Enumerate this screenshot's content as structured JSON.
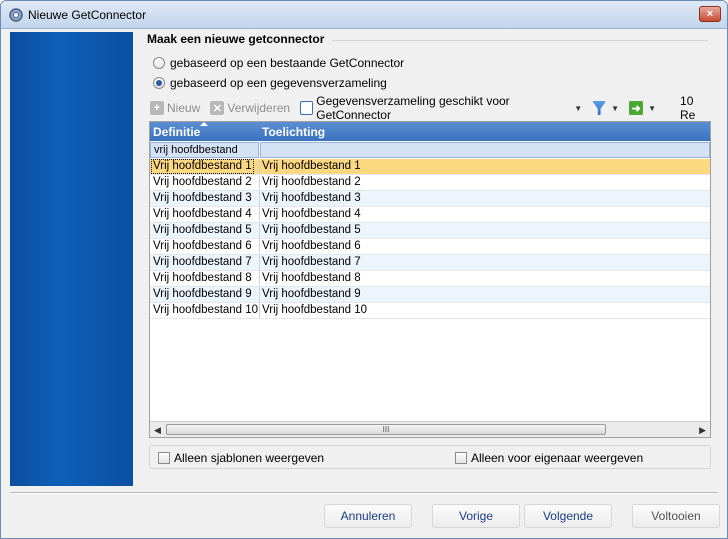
{
  "window": {
    "title": "Nieuwe GetConnector",
    "close_label": "×"
  },
  "section": {
    "title": "Maak een nieuwe getconnector"
  },
  "options": [
    {
      "label": "gebaseerd op een bestaande GetConnector",
      "selected": false
    },
    {
      "label": "gebaseerd op een gegevensverzameling",
      "selected": true
    }
  ],
  "toolbar": {
    "new_label": "Nieuw",
    "delete_label": "Verwijderen",
    "dataset_label": "Gegevensverzameling geschikt voor GetConnector",
    "record_count": "10 Re"
  },
  "grid": {
    "columns": [
      "Definitie",
      "Toelichting"
    ],
    "filter_value": "vrij hoofdbestand",
    "rows": [
      [
        "Vrij hoofdbestand  1",
        "Vrij hoofdbestand  1"
      ],
      [
        "Vrij hoofdbestand  2",
        "Vrij hoofdbestand  2"
      ],
      [
        "Vrij hoofdbestand  3",
        "Vrij hoofdbestand  3"
      ],
      [
        "Vrij hoofdbestand  4",
        "Vrij hoofdbestand  4"
      ],
      [
        "Vrij hoofdbestand  5",
        "Vrij hoofdbestand  5"
      ],
      [
        "Vrij hoofdbestand  6",
        "Vrij hoofdbestand  6"
      ],
      [
        "Vrij hoofdbestand  7",
        "Vrij hoofdbestand  7"
      ],
      [
        "Vrij hoofdbestand  8",
        "Vrij hoofdbestand  8"
      ],
      [
        "Vrij hoofdbestand  9",
        "Vrij hoofdbestand  9"
      ],
      [
        "Vrij hoofdbestand 10",
        "Vrij hoofdbestand 10"
      ]
    ],
    "selected_row": 0,
    "scroll_thumb_label": "III"
  },
  "filters": {
    "templates_label": "Alleen sjablonen weergeven",
    "owner_label": "Alleen voor eigenaar weergeven"
  },
  "buttons": {
    "cancel": "Annuleren",
    "previous": "Vorige",
    "next": "Volgende",
    "finish": "Voltooien"
  },
  "colors": {
    "side_panel": "#0e5fba",
    "header": "#3a71c0",
    "selected_row": "#fcd880"
  }
}
